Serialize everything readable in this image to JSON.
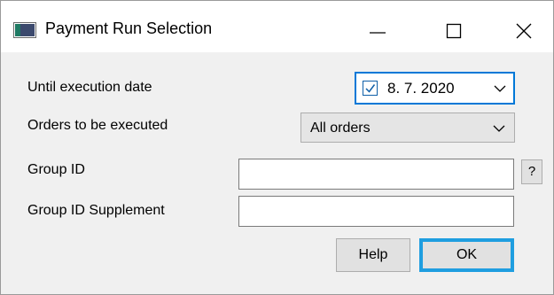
{
  "window": {
    "title": "Payment Run Selection"
  },
  "form": {
    "execution_date_label": "Until execution date",
    "execution_date_value": "8.  7. 2020",
    "execution_date_checked": true,
    "orders_label": "Orders to be executed",
    "orders_value": "All orders",
    "group_id_label": "Group ID",
    "group_id_value": "",
    "group_id_lookup_label": "?",
    "group_id_supplement_label": "Group ID Supplement",
    "group_id_supplement_value": ""
  },
  "buttons": {
    "help_label": "Help",
    "ok_label": "OK"
  },
  "colors": {
    "focus_border": "#0078d7",
    "default_button_border": "#1f9ee0",
    "dialog_background": "#f0f0f0"
  }
}
